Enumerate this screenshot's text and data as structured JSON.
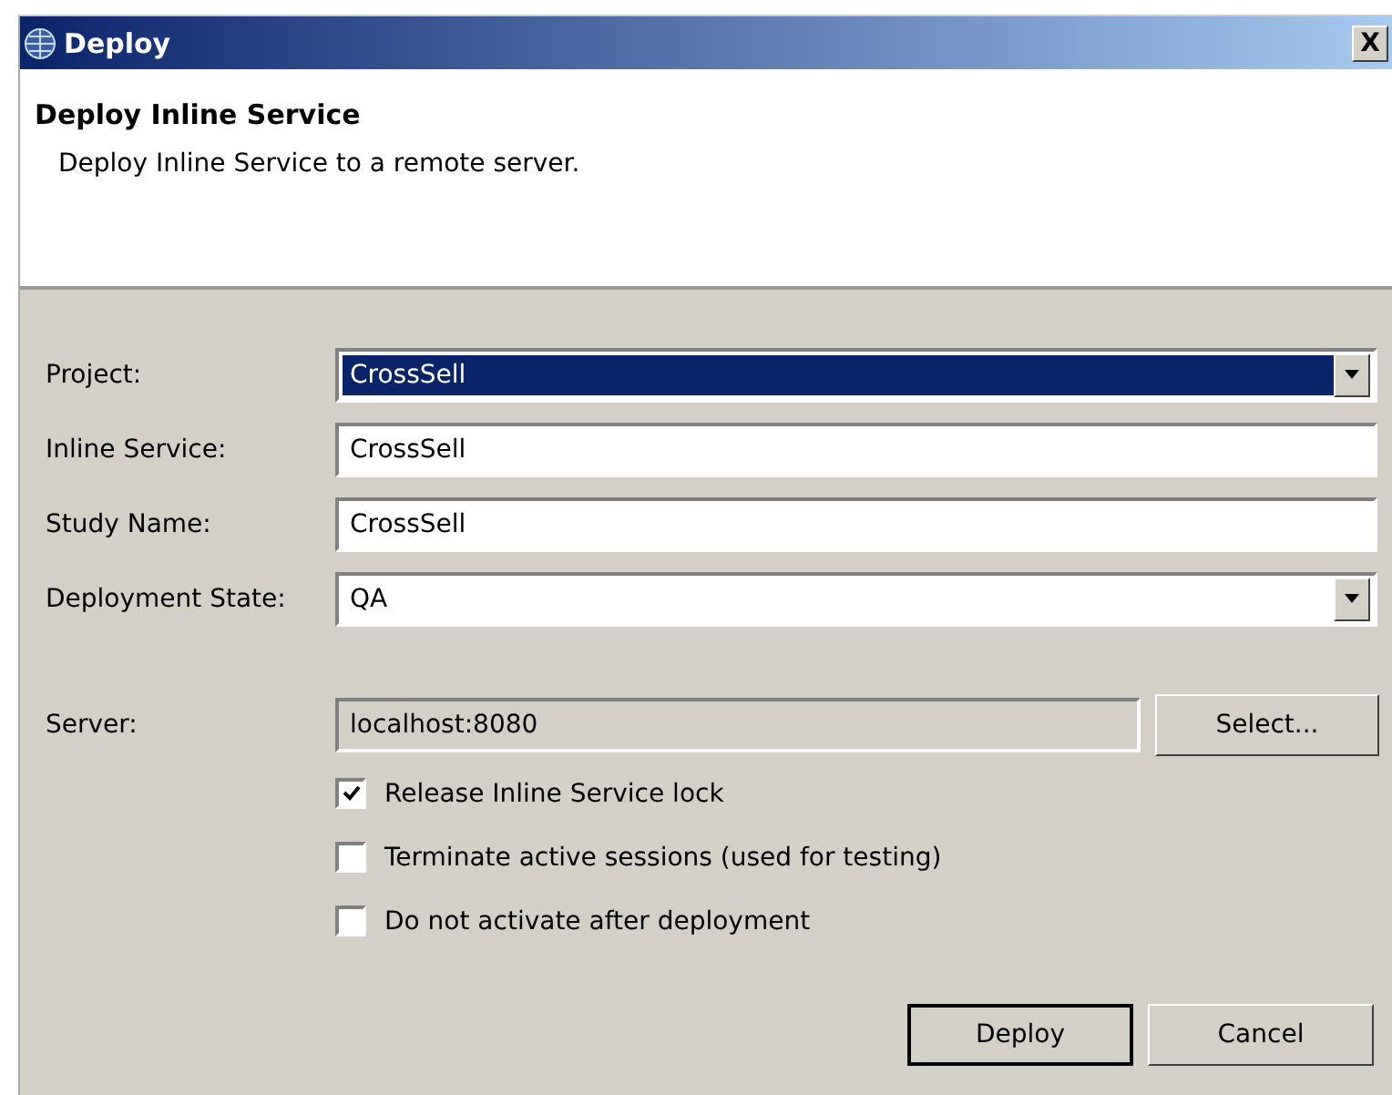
{
  "window": {
    "title": "Deploy",
    "close": "X"
  },
  "header": {
    "title": "Deploy Inline Service",
    "description": "Deploy Inline Service to a remote server."
  },
  "fields": [
    {
      "kind": "combo",
      "label": "Project:",
      "value": "CrossSell",
      "selected": true
    },
    {
      "kind": "text",
      "label": "Inline Service:",
      "value": "CrossSell",
      "selected": false
    },
    {
      "kind": "text",
      "label": "Study Name:",
      "value": "CrossSell",
      "selected": false
    },
    {
      "kind": "combo",
      "label": "Deployment State:",
      "value": "QA",
      "selected": false
    }
  ],
  "server": {
    "label": "Server:",
    "value": "localhost:8080",
    "disabled": true,
    "button": "Select..."
  },
  "options": [
    {
      "label": "Release Inline Service lock",
      "checked": true
    },
    {
      "label": "Terminate active sessions (used for testing)",
      "checked": false
    },
    {
      "label": "Do not activate after deployment",
      "checked": false
    }
  ],
  "buttons": [
    {
      "label": "Deploy",
      "default": true
    },
    {
      "label": "Cancel",
      "default": false
    }
  ]
}
